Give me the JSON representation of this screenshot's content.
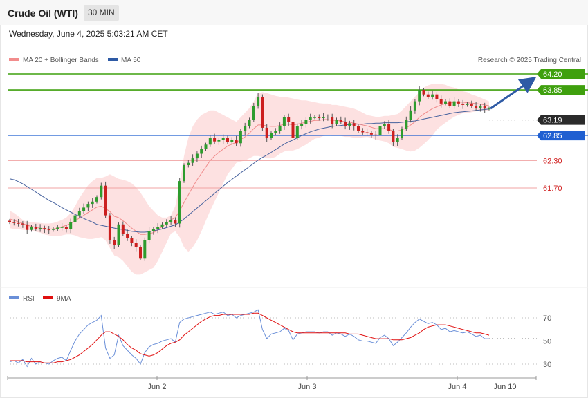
{
  "header": {
    "title": "Crude Oil (WTI)",
    "timeframe": "30 MIN"
  },
  "datetime": "Wednesday, June 4, 2025 5:03:21 AM CET",
  "legend": {
    "ma20_label": "MA 20 + Bollinger Bands",
    "ma50_label": "MA 50"
  },
  "credit": "Research © 2025 Trading Central",
  "colors": {
    "up": "#2e9c2e",
    "down": "#cc1f1f",
    "resistance": "#3fa00e",
    "pivot": "#1f5fd1",
    "support": "#e04b4b",
    "ma50": "#46629e",
    "band_fill": "#fddcdc",
    "ma20": "#f08a8a",
    "arrow": "#2e5aa5",
    "rsi": "#6a8fd8",
    "rsi_ma": "#e01010",
    "current": "#2b2b2b"
  },
  "chart_data": [
    {
      "type": "candlestick",
      "title": "Crude Oil (WTI)",
      "timeframe": "30 MIN",
      "y_range": [
        61.1,
        64.5
      ],
      "x_ticks": [
        "Jun 2",
        "Jun 3",
        "Jun 4",
        "Jun 10"
      ],
      "levels": [
        {
          "value": 64.2,
          "label": "64.20",
          "kind": "resistance"
        },
        {
          "value": 63.85,
          "label": "63.85",
          "kind": "resistance"
        },
        {
          "value": 63.19,
          "label": "63.19",
          "kind": "current"
        },
        {
          "value": 62.85,
          "label": "62.85",
          "kind": "pivot"
        },
        {
          "value": 62.3,
          "label": "62.30",
          "kind": "support"
        },
        {
          "value": 61.7,
          "label": "61.70",
          "kind": "support"
        }
      ],
      "closes": [
        60.95,
        60.93,
        60.92,
        60.9,
        60.78,
        60.85,
        60.8,
        60.82,
        60.79,
        60.78,
        60.8,
        60.83,
        60.84,
        60.8,
        60.95,
        61.1,
        61.2,
        61.27,
        61.35,
        61.4,
        61.5,
        61.75,
        61.1,
        60.55,
        60.45,
        60.9,
        60.7,
        60.6,
        60.5,
        60.4,
        60.15,
        60.55,
        60.75,
        60.8,
        60.85,
        60.9,
        60.95,
        61.0,
        60.92,
        61.85,
        62.2,
        62.25,
        62.35,
        62.45,
        62.55,
        62.65,
        62.8,
        62.72,
        62.75,
        62.8,
        62.7,
        62.75,
        62.68,
        62.95,
        63.05,
        63.2,
        63.5,
        63.7,
        63.02,
        62.8,
        62.9,
        62.95,
        63.05,
        63.25,
        63.15,
        62.8,
        63.05,
        63.1,
        63.2,
        63.25,
        63.25,
        63.23,
        63.26,
        63.25,
        63.1,
        63.2,
        63.15,
        63.05,
        63.12,
        63.05,
        62.95,
        62.92,
        62.9,
        62.87,
        62.85,
        63.05,
        63.1,
        62.95,
        62.7,
        62.8,
        63.0,
        63.2,
        63.4,
        63.6,
        63.85,
        63.75,
        63.7,
        63.75,
        63.65,
        63.55,
        63.6,
        63.5,
        63.6,
        63.55,
        63.52,
        63.55,
        63.5,
        63.45,
        63.49,
        63.44,
        63.44
      ],
      "ma20": [
        61.02,
        60.99,
        60.96,
        60.92,
        60.88,
        60.86,
        60.83,
        60.82,
        60.8,
        60.8,
        60.8,
        60.82,
        60.85,
        60.88,
        60.92,
        60.98,
        61.04,
        61.1,
        61.16,
        61.22,
        61.28,
        61.3,
        61.25,
        61.18,
        61.08,
        61.05,
        60.98,
        60.9,
        60.82,
        60.75,
        60.68,
        60.68,
        60.7,
        60.72,
        60.78,
        60.85,
        60.92,
        61.0,
        61.05,
        61.2,
        61.38,
        61.55,
        61.72,
        61.88,
        62.02,
        62.16,
        62.3,
        62.4,
        62.48,
        62.55,
        62.62,
        62.66,
        62.7,
        62.76,
        62.82,
        62.9,
        63.0,
        63.08,
        63.08,
        63.06,
        63.05,
        63.05,
        63.07,
        63.1,
        63.1,
        63.08,
        63.1,
        63.12,
        63.14,
        63.16,
        63.18,
        63.18,
        63.2,
        63.2,
        63.18,
        63.18,
        63.17,
        63.15,
        63.14,
        63.12,
        63.1,
        63.08,
        63.06,
        63.03,
        63.0,
        63.0,
        63.0,
        62.98,
        62.95,
        62.95,
        62.97,
        63.02,
        63.08,
        63.15,
        63.25,
        63.32,
        63.38,
        63.44,
        63.48,
        63.52,
        63.55,
        63.56,
        63.58,
        63.58,
        63.58,
        63.57,
        63.56,
        63.55,
        63.54,
        63.52,
        63.5
      ],
      "ma50": [
        61.9,
        61.88,
        61.84,
        61.79,
        61.73,
        61.67,
        61.61,
        61.55,
        61.49,
        61.43,
        61.38,
        61.33,
        61.27,
        61.22,
        61.17,
        61.12,
        61.08,
        61.03,
        60.99,
        60.95,
        60.9,
        60.88,
        60.86,
        60.84,
        60.82,
        60.8,
        60.79,
        60.77,
        60.75,
        60.74,
        60.73,
        60.73,
        60.74,
        60.76,
        60.78,
        60.8,
        60.83,
        60.86,
        60.89,
        60.95,
        61.02,
        61.1,
        61.18,
        61.26,
        61.34,
        61.42,
        61.5,
        61.58,
        61.66,
        61.74,
        61.82,
        61.89,
        61.96,
        62.03,
        62.1,
        62.17,
        62.24,
        62.31,
        62.37,
        62.42,
        62.48,
        62.54,
        62.6,
        62.66,
        62.71,
        62.75,
        62.8,
        62.85,
        62.89,
        62.93,
        62.96,
        62.99,
        63.01,
        63.03,
        63.05,
        63.06,
        63.07,
        63.08,
        63.09,
        63.1,
        63.1,
        63.1,
        63.11,
        63.11,
        63.12,
        63.12,
        63.13,
        63.13,
        63.13,
        63.13,
        63.14,
        63.15,
        63.16,
        63.17,
        63.19,
        63.21,
        63.23,
        63.25,
        63.27,
        63.29,
        63.31,
        63.33,
        63.35,
        63.36,
        63.37,
        63.38,
        63.39,
        63.4,
        63.41,
        63.42,
        63.43
      ],
      "bollinger_upper": [
        61.2,
        61.15,
        61.08,
        61.0,
        60.95,
        60.95,
        60.94,
        60.93,
        60.92,
        60.92,
        60.93,
        60.96,
        61.0,
        61.05,
        61.15,
        61.3,
        61.48,
        61.62,
        61.76,
        61.85,
        61.92,
        61.92,
        61.95,
        62.0,
        61.95,
        61.9,
        61.88,
        61.85,
        61.8,
        61.72,
        61.6,
        61.45,
        61.3,
        61.2,
        61.1,
        61.05,
        61.05,
        61.1,
        61.3,
        61.8,
        62.4,
        62.8,
        63.05,
        63.2,
        63.3,
        63.35,
        63.4,
        63.4,
        63.35,
        63.3,
        63.25,
        63.2,
        63.15,
        63.25,
        63.35,
        63.45,
        63.6,
        63.78,
        63.8,
        63.78,
        63.75,
        63.72,
        63.7,
        63.7,
        63.68,
        63.66,
        63.64,
        63.62,
        63.62,
        63.6,
        63.58,
        63.56,
        63.55,
        63.55,
        63.52,
        63.52,
        63.5,
        63.48,
        63.46,
        63.44,
        63.4,
        63.35,
        63.3,
        63.28,
        63.26,
        63.26,
        63.28,
        63.28,
        63.3,
        63.32,
        63.4,
        63.5,
        63.6,
        63.7,
        63.8,
        63.9,
        63.95,
        63.98,
        63.98,
        63.98,
        63.96,
        63.92,
        63.9,
        63.86,
        63.82,
        63.8,
        63.75,
        63.72,
        63.68,
        63.64,
        63.6
      ],
      "bollinger_lower": [
        60.82,
        60.8,
        60.8,
        60.78,
        60.78,
        60.77,
        60.74,
        60.72,
        60.68,
        60.66,
        60.64,
        60.64,
        60.66,
        60.68,
        60.68,
        60.66,
        60.62,
        60.6,
        60.58,
        60.58,
        60.6,
        60.62,
        60.55,
        60.38,
        60.22,
        60.18,
        60.1,
        59.98,
        59.86,
        59.8,
        59.8,
        59.85,
        59.9,
        59.95,
        60.1,
        60.3,
        60.5,
        60.7,
        60.75,
        60.62,
        60.4,
        60.3,
        60.4,
        60.55,
        60.75,
        60.98,
        61.2,
        61.4,
        61.6,
        61.8,
        62.0,
        62.12,
        62.25,
        62.28,
        62.3,
        62.35,
        62.4,
        62.4,
        62.38,
        62.35,
        62.35,
        62.38,
        62.45,
        62.5,
        62.52,
        62.52,
        62.55,
        62.6,
        62.65,
        62.72,
        62.78,
        62.8,
        62.84,
        62.85,
        62.84,
        62.84,
        62.84,
        62.82,
        62.82,
        62.8,
        62.8,
        62.81,
        62.82,
        62.8,
        62.76,
        62.74,
        62.72,
        62.68,
        62.6,
        62.58,
        62.55,
        62.52,
        62.5,
        62.52,
        62.58,
        62.66,
        62.75,
        62.85,
        62.98,
        63.06,
        63.13,
        63.2,
        63.26,
        63.3,
        63.34,
        63.34,
        63.36,
        63.38,
        63.4,
        63.4,
        63.4
      ]
    },
    {
      "type": "line",
      "title": "RSI",
      "y_range": [
        20,
        80
      ],
      "y_ticks": [
        30,
        50,
        70
      ],
      "series": [
        {
          "name": "RSI",
          "values": [
            32,
            33,
            31,
            34,
            28,
            35,
            30,
            32,
            31,
            30,
            33,
            35,
            36,
            33,
            42,
            50,
            56,
            60,
            64,
            66,
            68,
            72,
            44,
            35,
            38,
            55,
            46,
            42,
            38,
            35,
            30,
            40,
            45,
            47,
            48,
            50,
            51,
            52,
            49,
            66,
            69,
            70,
            71,
            72,
            73,
            74,
            75,
            73,
            74,
            75,
            72,
            73,
            70,
            72,
            73,
            74,
            75,
            77,
            60,
            52,
            56,
            57,
            58,
            61,
            59,
            51,
            56,
            57,
            58,
            58,
            58,
            57,
            58,
            58,
            55,
            57,
            56,
            54,
            56,
            54,
            51,
            50,
            50,
            49,
            48,
            53,
            55,
            52,
            46,
            49,
            53,
            57,
            62,
            66,
            69,
            67,
            65,
            66,
            64,
            60,
            61,
            58,
            59,
            58,
            57,
            58,
            56,
            54,
            55,
            52,
            52
          ]
        },
        {
          "name": "9MA",
          "values": [
            33,
            33,
            33,
            33,
            32,
            32,
            32,
            32,
            31,
            31,
            31,
            32,
            32,
            33,
            34,
            36,
            38,
            41,
            44,
            47,
            51,
            55,
            58,
            58,
            56,
            54,
            51,
            47,
            44,
            42,
            39,
            38,
            37,
            38,
            40,
            43,
            46,
            48,
            49,
            51,
            55,
            58,
            61,
            64,
            67,
            69,
            71,
            72,
            72,
            73,
            73,
            73,
            73,
            73,
            73,
            73,
            74,
            74,
            72,
            70,
            68,
            66,
            64,
            62,
            60,
            58,
            57,
            57,
            57,
            57,
            57,
            57,
            57,
            57,
            57,
            57,
            57,
            57,
            56,
            56,
            56,
            55,
            54,
            53,
            52,
            52,
            52,
            52,
            51,
            51,
            51,
            52,
            53,
            55,
            57,
            60,
            62,
            63,
            64,
            64,
            64,
            63,
            62,
            61,
            60,
            59,
            58,
            57,
            57,
            56,
            55
          ]
        }
      ]
    }
  ]
}
